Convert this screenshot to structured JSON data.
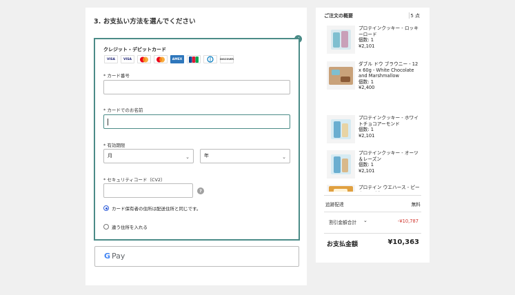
{
  "payment": {
    "step_title": "3. お支払い方法を選んでください",
    "method_title": "クレジット・デビットカード",
    "card_logos": [
      "VISA",
      "VISA",
      "mastercard",
      "mastercard",
      "AMEX",
      "JCB",
      "Diners",
      "DISCOVER"
    ],
    "card_number_label": "* カード番号",
    "card_number_value": "",
    "card_name_label": "* カードでのお名前",
    "card_name_value": "",
    "expiry_label": "* 有効期限",
    "month_select": "月",
    "year_select": "年",
    "security_label": "* セキュリティコード（CV2）",
    "security_value": "",
    "help_icon": "?",
    "same_address_label": "カード保有者の住所は配送住所と同じです。",
    "different_address_label": "違う住所を入れる",
    "same_address_selected": true,
    "gpay_g": "G",
    "gpay_label": "Pay"
  },
  "summary": {
    "title": "ご注文の概要",
    "count": "5 点",
    "items": [
      {
        "name": "プロテインクッキー - ロッキーロード",
        "qty": "個数: 1",
        "price": "¥2,101",
        "color": "#7fbfd0"
      },
      {
        "name": "ダブル ドウ ブラウニー - 12 x 60g - White Chocolate and Marshmallow",
        "qty": "個数: 1",
        "price": "¥2,400",
        "color": "#b07a4a"
      },
      {
        "name": "プロテインクッキー - ホワイトチョコアーモンド",
        "qty": "個数: 1",
        "price": "¥2,101",
        "color": "#6aaed0"
      },
      {
        "name": "プロテインクッキー - オーツ＆レーズン",
        "qty": "個数: 1",
        "price": "¥2,101",
        "color": "#6aaed0"
      },
      {
        "name": "プロテイン ウエハース - ピーナッツバター",
        "qty": "",
        "price": "",
        "color": "#e0a040"
      }
    ],
    "shipping_label": "追跡配達",
    "shipping_value": "無料",
    "discount_label": "割引金額合計",
    "discount_value": "-¥10,787",
    "total_label": "お支払金額",
    "total_value": "¥10,363"
  }
}
